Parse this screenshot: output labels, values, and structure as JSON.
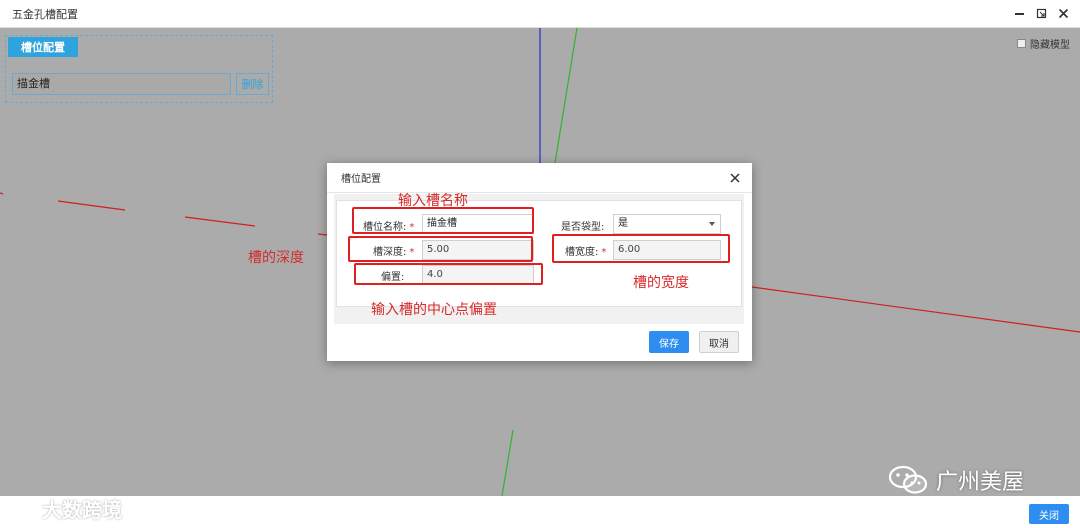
{
  "window": {
    "title": "五金孔槽配置"
  },
  "viewport": {
    "hide_model_label": "隐藏模型",
    "hide_model_checked": false
  },
  "slot_panel": {
    "tab_label": "槽位配置",
    "slot_name_value": "描金槽",
    "delete_label": "删除"
  },
  "dialog": {
    "title": "槽位配置",
    "fields": {
      "slot_name_label": "槽位名称:",
      "slot_name_value": "描金槽",
      "pocket_label": "是否袋型:",
      "pocket_value": "是",
      "depth_label": "槽深度:",
      "depth_value": "5.00",
      "width_label": "槽宽度:",
      "width_value": "6.00",
      "offset_label": "偏置:",
      "offset_value": "4.0"
    },
    "required_mark": "*",
    "save_label": "保存",
    "cancel_label": "取消"
  },
  "annotations": {
    "name_hint": "输入槽名称",
    "depth_hint": "槽的深度",
    "width_hint": "槽的宽度",
    "offset_hint": "输入槽的中心点偏置"
  },
  "footer": {
    "close_label": "关闭"
  },
  "watermarks": {
    "left": "大数跨境",
    "right": "广州美屋"
  },
  "colors": {
    "accent": "#2e8df0",
    "tab": "#2ea3dd",
    "annotation": "#d62b2b",
    "viewport_bg": "#ababab"
  }
}
